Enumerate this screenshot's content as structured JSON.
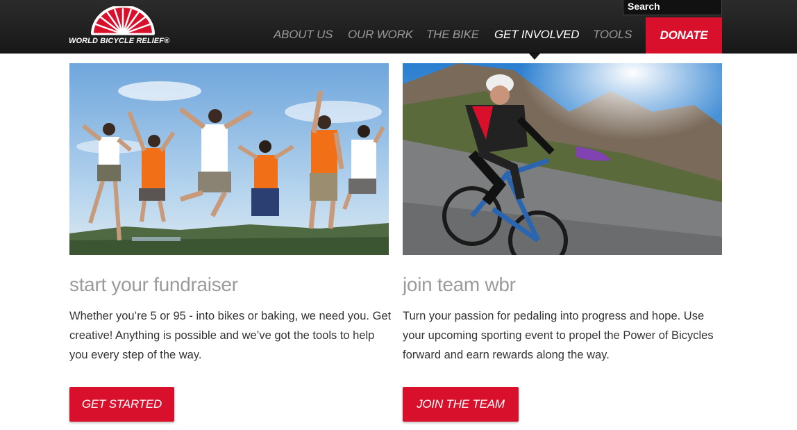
{
  "brand": {
    "logo_text": "WORLD BICYCLE RELIEF®",
    "accent": "#d8102c"
  },
  "search": {
    "label": "Search"
  },
  "nav": {
    "items": [
      {
        "label": "ABOUT US"
      },
      {
        "label": "OUR WORK"
      },
      {
        "label": "THE BIKE"
      },
      {
        "label": "GET INVOLVED",
        "active": true
      },
      {
        "label": "TOOLS"
      }
    ],
    "donate_label": "DONATE"
  },
  "cards": [
    {
      "title": "start your fundraiser",
      "body": "Whether you’re 5 or 95 - into bikes or baking, we need you. Get creative! Anything is possible and we’ve got the tools to help you every step of the way.",
      "button": "GET STARTED"
    },
    {
      "title": "join team wbr",
      "body": "Turn your passion for pedaling into progress and hope. Use your upcoming sporting event to propel the Power of Bicycles forward and earn rewards along the way.",
      "button": "JOIN THE TEAM"
    }
  ]
}
